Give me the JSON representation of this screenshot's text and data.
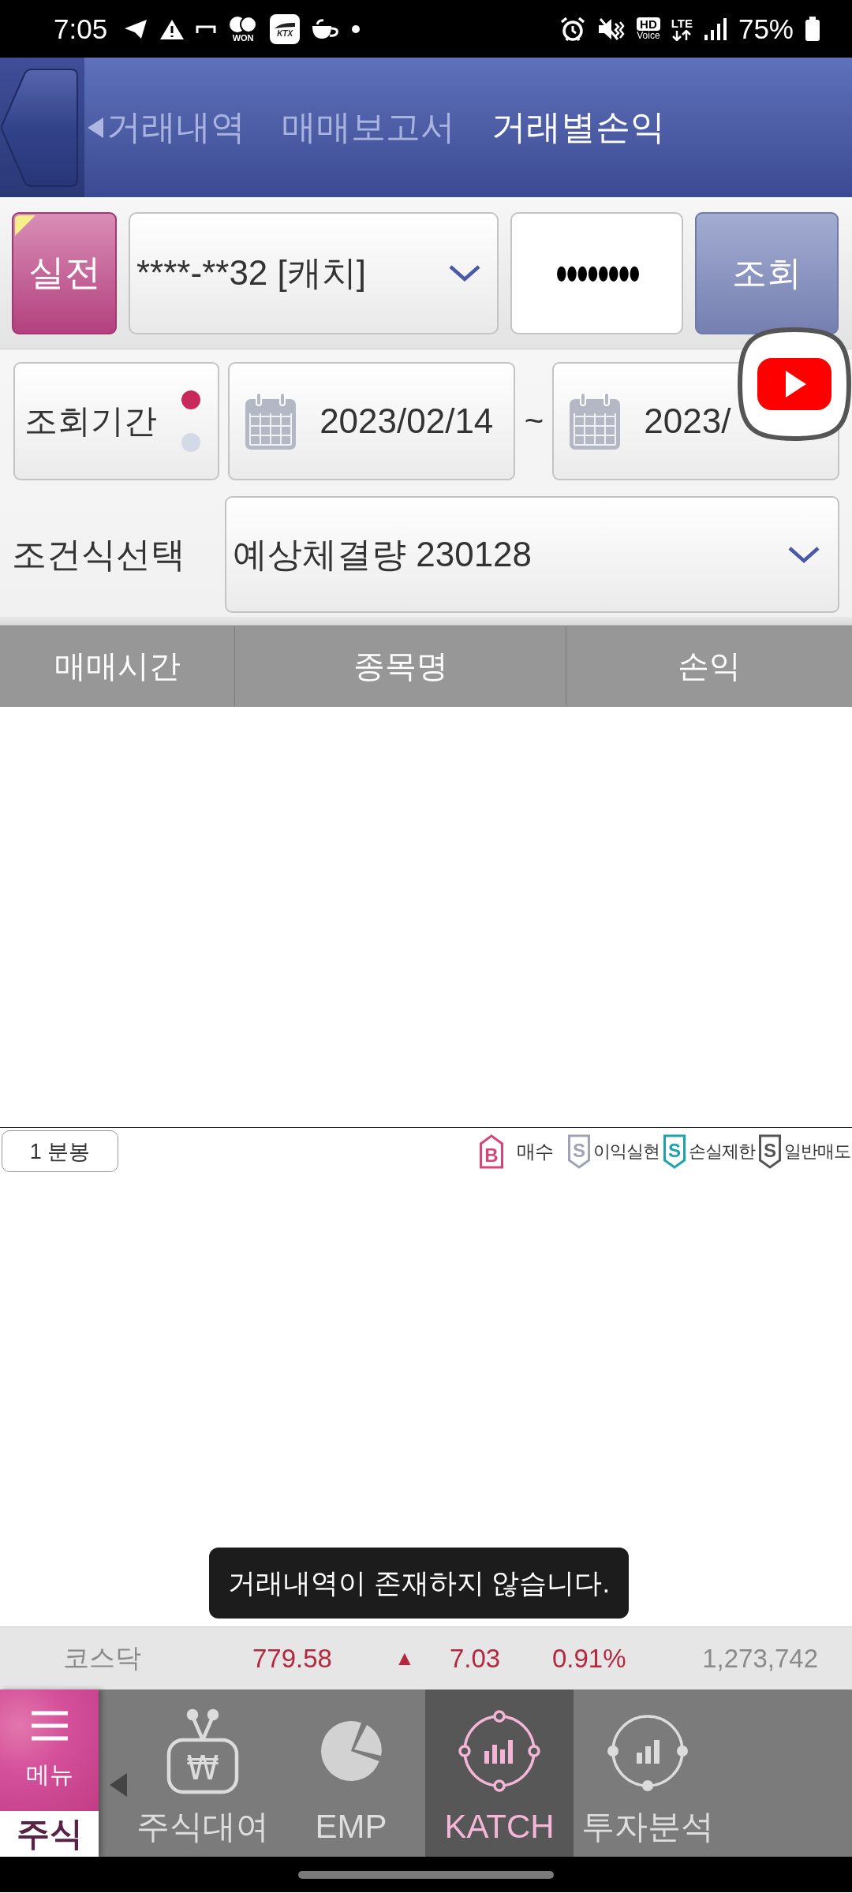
{
  "status_bar": {
    "time": "7:05",
    "won_label": "WON",
    "train_label": "KTX",
    "hd_label": "HD",
    "voice_label": "Voice",
    "network_label": "LTE",
    "battery": "75%"
  },
  "header": {
    "tabs": [
      {
        "label": "거래내역",
        "selected": false
      },
      {
        "label": "매매보고서",
        "selected": false
      },
      {
        "label": "거래별손익",
        "selected": true
      }
    ]
  },
  "query_bar": {
    "mode_button": "실전",
    "account": "****-**32 [캐치]",
    "password": "●●●●●●●●",
    "search_button": "조회"
  },
  "period": {
    "label": "조회기간",
    "options": [
      {
        "selected": true
      },
      {
        "selected": false
      }
    ],
    "start_date": "2023/02/14",
    "separator": "~",
    "end_date": "2023/"
  },
  "condition": {
    "label": "조건식선택",
    "value": "예상체결량 230128"
  },
  "table": {
    "columns": [
      "매매시간",
      "종목명",
      "손익"
    ]
  },
  "chart_footer": {
    "interval_button": "1 분봉",
    "legend": [
      {
        "kind": "buy",
        "letter": "B",
        "label": "매수",
        "color": "#d6457a"
      },
      {
        "kind": "sell",
        "letter": "S",
        "label": "이익실현",
        "color": "#a0a2b8"
      },
      {
        "kind": "sell",
        "letter": "S",
        "label": "손실제한",
        "color": "#1aa3ad"
      },
      {
        "kind": "sell",
        "letter": "S",
        "label": "일반매도",
        "color": "#555555"
      }
    ]
  },
  "ticker": {
    "name": "코스닥",
    "value": "779.58",
    "arrow": "▲",
    "change": "7.03",
    "rate": "0.91%",
    "volume": "1,273,742"
  },
  "toast": "거래내역이 존재하지 않습니다.",
  "bottom_nav": {
    "menu_label": "메뉴",
    "section_label": "주식",
    "items": [
      {
        "kind": "loan",
        "label": "주식대여",
        "symbol": "₩",
        "selected": false
      },
      {
        "kind": "pie",
        "label": "EMP",
        "selected": false
      },
      {
        "kind": "katch",
        "label": "KATCH",
        "selected": true
      },
      {
        "kind": "analysis",
        "label": "투자분석",
        "selected": false
      }
    ]
  }
}
